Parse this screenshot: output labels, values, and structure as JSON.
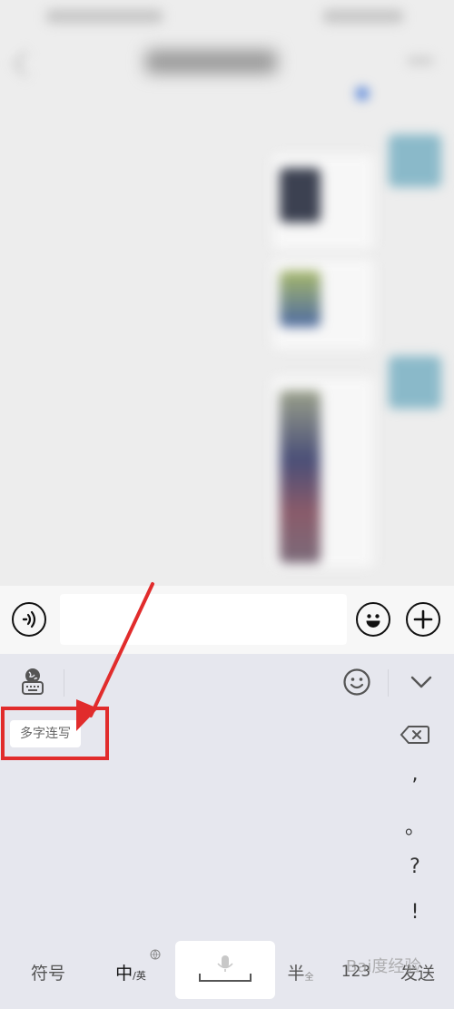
{
  "keyboard": {
    "multi_char_label": "多字连写",
    "punctuation": [
      ",",
      "。",
      "?",
      "!"
    ],
    "bottom_row": {
      "symbols": "符号",
      "zh": "中",
      "en_sub": "/英",
      "half_width": "半",
      "half_sub": "全",
      "numbers": "123",
      "send": "发送"
    }
  },
  "watermark": {
    "text": "Bai度经验"
  },
  "colors": {
    "annotation_red": "#e12c2c",
    "keyboard_bg": "#e6e7ee",
    "chat_bg": "#ededed"
  },
  "icons": {
    "voice": "voice-wave-icon",
    "emoji": "emoji-smile-icon",
    "plus": "plus-circle-icon",
    "kb_settings": "globe-keyboard-icon",
    "kb_emoji": "emoji-outline-icon",
    "collapse": "chevron-down-icon",
    "backspace": "backspace-icon",
    "mic": "microphone-icon"
  }
}
